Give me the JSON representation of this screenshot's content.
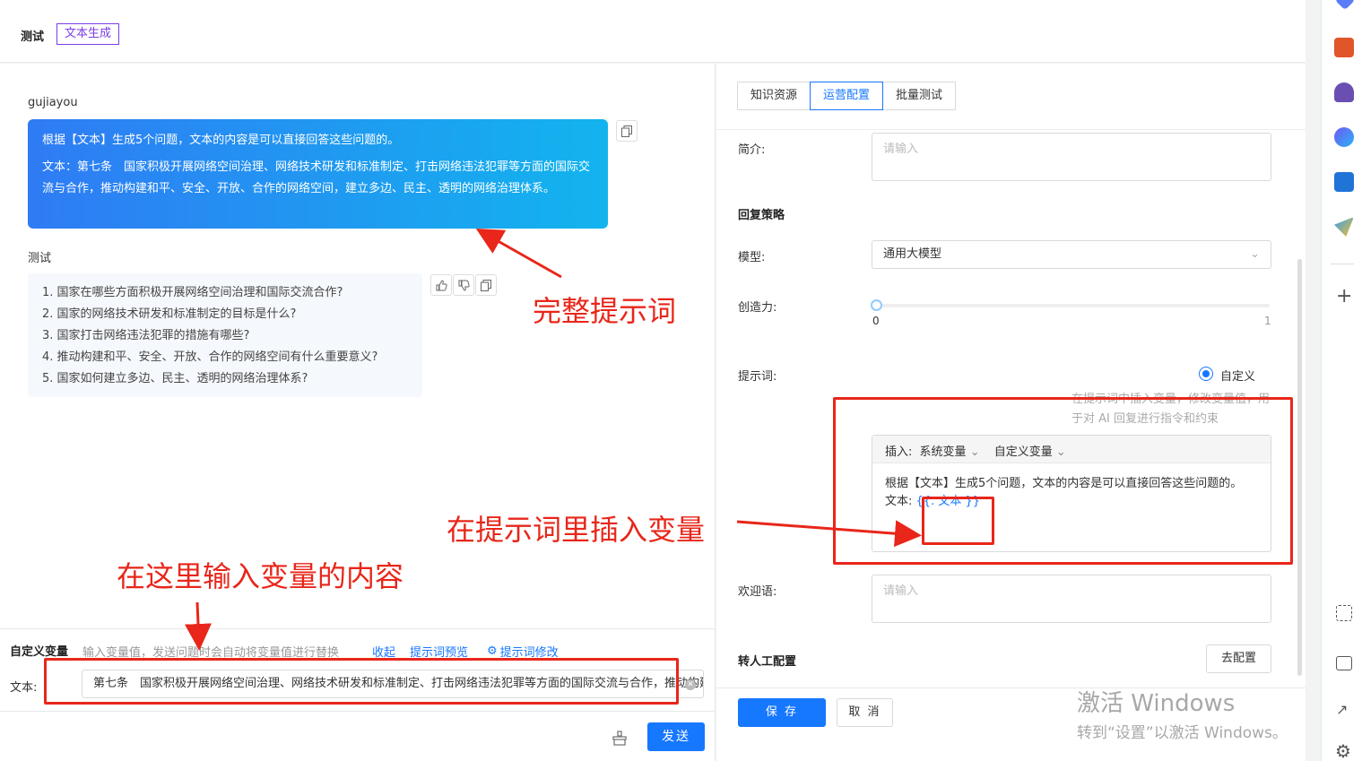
{
  "header": {
    "title": "测试",
    "tag": "文本生成"
  },
  "chat": {
    "user_name": "gujiayou",
    "user_message_line1": "根据【文本】生成5个问题，文本的内容是可以直接回答这些问题的。",
    "user_message_line2": "文本：第七条　国家积极开展网络空间治理、网络技术研发和标准制定、打击网络违法犯罪等方面的国际交流与合作，推动构建和平、安全、开放、合作的网络空间，建立多边、民主、透明的网络治理体系。",
    "bot_name": "测试",
    "bot_items": [
      "1. 国家在哪些方面积极开展网络空间治理和国际交流合作?",
      "2. 国家的网络技术研发和标准制定的目标是什么?",
      "3. 国家打击网络违法犯罪的措施有哪些?",
      "4. 推动构建和平、安全、开放、合作的网络空间有什么重要意义?",
      "5. 国家如何建立多边、民主、透明的网络治理体系?"
    ]
  },
  "variables": {
    "title": "自定义变量",
    "hint": "输入变量值，发送问题时会自动将变量值进行替换",
    "collapse": "收起",
    "preview": "提示词预览",
    "edit": "提示词修改",
    "label": "文本:",
    "value": "第七条　国家积极开展网络空间治理、网络技术研发和标准制定、打击网络违法犯罪等方面的国际交流与合作，推动构建和平、安全、开放、合作的网络空间，建立多边、民主、透明的网络治理体系。"
  },
  "send_label": "发送",
  "config": {
    "tabs": [
      "知识资源",
      "运营配置",
      "批量测试"
    ],
    "active_tab": 1,
    "intro_label": "简介:",
    "intro_placeholder": "请输入",
    "reply_title": "回复策略",
    "model_label": "模型:",
    "model_value": "通用大模型",
    "creativity_label": "创造力:",
    "slider_min": "0",
    "slider_max": "1",
    "slider_value": 0,
    "prompt_label": "提示词:",
    "prompt_mode": "自定义",
    "prompt_hint": "在提示词中插入变量，修改变量值，用于对 AI 回复进行指令和约束",
    "insert_label": "插入:",
    "system_var": "系统变量",
    "custom_var": "自定义变量",
    "prompt_line1": "根据【文本】生成5个问题，文本的内容是可以直接回答这些问题的。",
    "prompt_line2_prefix": "文本:",
    "prompt_var": "{{. 文本 }}",
    "welcome_label": "欢迎语:",
    "welcome_placeholder": "请输入",
    "handoff_label": "转人工配置",
    "handoff_button": "去配置",
    "save": "保 存",
    "cancel": "取 消"
  },
  "watermark": {
    "line1": "激活 Windows",
    "line2": "转到“设置”以激活 Windows。"
  },
  "annotations": {
    "full_prompt": "完整提示词",
    "insert_var": "在提示词里插入变量",
    "input_var": "在这里输入变量的内容"
  },
  "colors": {
    "primary": "#1677ff",
    "annotation": "#e8261a",
    "tag": "#7b3fe4"
  }
}
